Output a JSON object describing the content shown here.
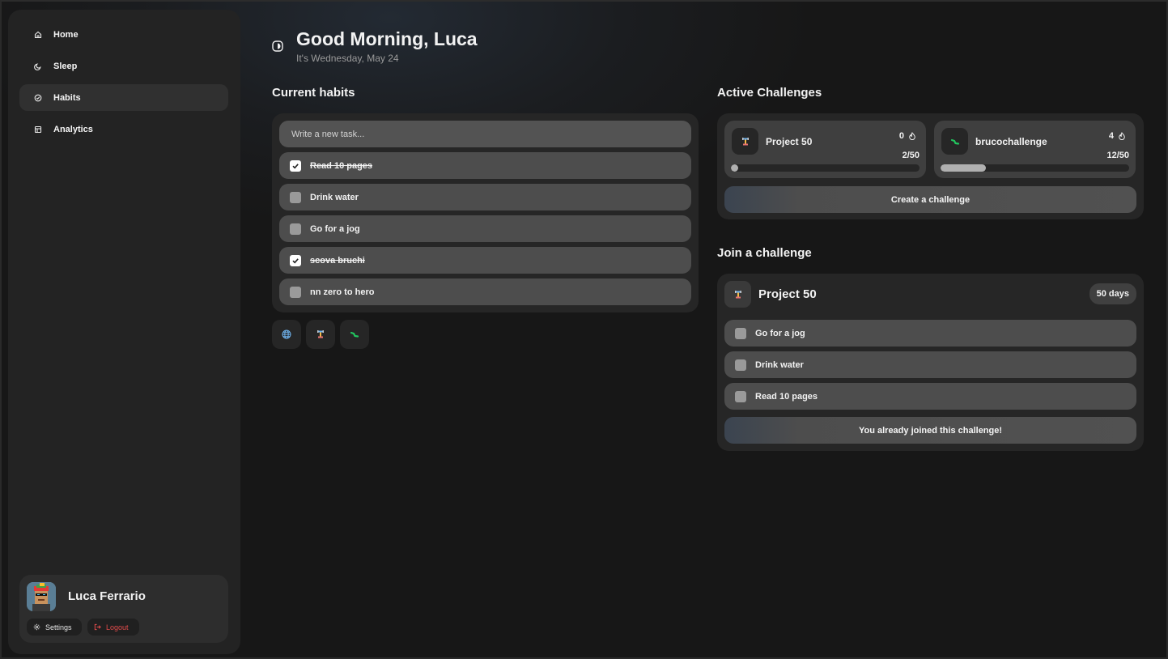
{
  "nav": {
    "items": [
      {
        "label": "Home",
        "icon": "home-icon",
        "active": false
      },
      {
        "label": "Sleep",
        "icon": "moon-icon",
        "active": false
      },
      {
        "label": "Habits",
        "icon": "check-circle-icon",
        "active": true
      },
      {
        "label": "Analytics",
        "icon": "layout-icon",
        "active": false
      }
    ]
  },
  "user": {
    "name": "Luca Ferrario",
    "settings_label": "Settings",
    "logout_label": "Logout"
  },
  "header": {
    "title": "Good Morning, Luca",
    "subtitle": "It's Wednesday, May 24"
  },
  "habits": {
    "section_title": "Current habits",
    "input_placeholder": "Write a new task...",
    "items": [
      {
        "label": "Read 10 pages",
        "done": true
      },
      {
        "label": "Drink water",
        "done": false
      },
      {
        "label": "Go for a jog",
        "done": false
      },
      {
        "label": "scova bruchi",
        "done": true
      },
      {
        "label": "nn zero to hero",
        "done": false
      }
    ],
    "filters": [
      "globe-icon",
      "dumbbell-icon",
      "caterpillar-icon"
    ]
  },
  "challenges": {
    "section_title": "Active Challenges",
    "cards": [
      {
        "name": "Project 50",
        "streak": "0",
        "progress_text": "2/50",
        "progress": 0.04,
        "icon": "dumbbell-icon"
      },
      {
        "name": "brucochallenge",
        "streak": "4",
        "progress_text": "12/50",
        "progress": 0.24,
        "icon": "caterpillar-icon"
      }
    ],
    "create_label": "Create a challenge"
  },
  "join": {
    "section_title": "Join a challenge",
    "name": "Project 50",
    "duration": "50 days",
    "tasks": [
      "Go for a jog",
      "Drink water",
      "Read 10 pages"
    ],
    "status_label": "You already joined this challenge!"
  },
  "colors": {
    "background": "#171717",
    "panel": "#262626",
    "row": "#4d4d4d",
    "logout": "#e24b4b",
    "caterpillar": "#22c55e"
  }
}
